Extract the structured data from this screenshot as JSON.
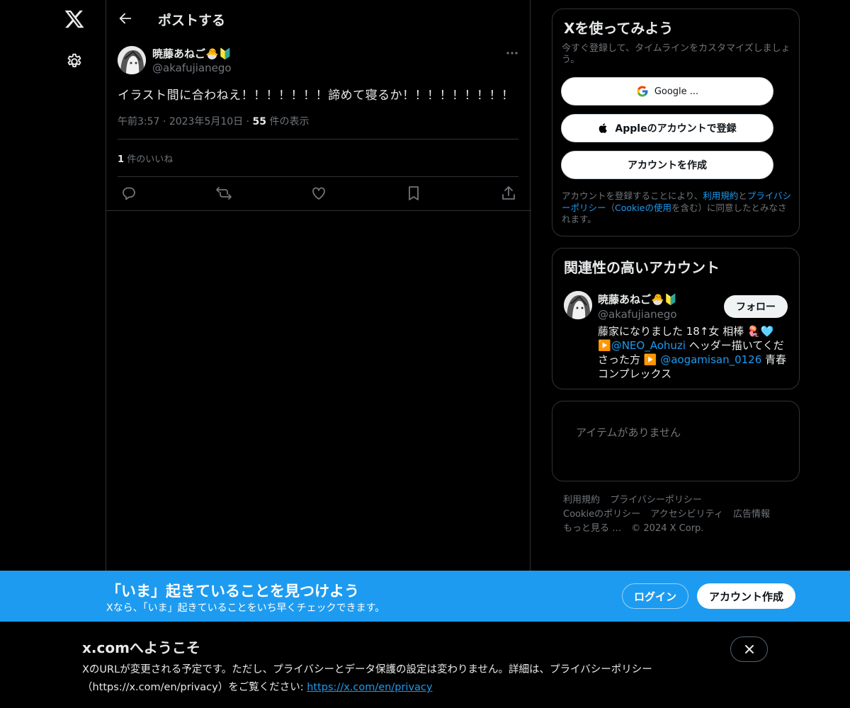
{
  "header": {
    "title": "ポストする"
  },
  "tweet": {
    "author_name": "暁藤あねご🐣🔰",
    "author_handle": "@akafujianego",
    "text": "イラスト間に合わねえ！！！！！！！諦めて寝るか！！！！！！！！！",
    "time": "午前3:57",
    "date": "2023年5月10日",
    "views_count": "55",
    "views_label": "件の表示",
    "likes_count": "1",
    "likes_label": "件のいいね"
  },
  "signup_card": {
    "title": "Xを使ってみよう",
    "subtitle": "今すぐ登録して、タイムラインをカスタマイズしましょう。",
    "google_label": "Google ...",
    "apple_label": "Appleのアカウントで登録",
    "create_label": "アカウントを作成",
    "terms_prefix": "アカウントを登録することにより、",
    "terms_link": "利用規約",
    "terms_and": "と",
    "privacy_link": "プライバシーポリシー",
    "terms_mid": "（",
    "cookie_link": "Cookieの使用",
    "terms_suffix": "を含む）に同意したとみなされます。"
  },
  "related": {
    "title": "関連性の高いアカウント",
    "name": "暁藤あねご🐣🔰",
    "handle": "@akafujianego",
    "follow_label": "フォロー",
    "bio_1": "藤家になりました 18↑女 相棒 🪼🩵▶️",
    "bio_link1": "@NEO_Aohuzi",
    "bio_2": " ヘッダー描いてくださった方 ▶️ ",
    "bio_link2": "@aogamisan_0126",
    "bio_3": " 青春コンプレックス"
  },
  "empty_card": {
    "text": "アイテムがありません"
  },
  "footer": {
    "terms": "利用規約",
    "privacy": "プライバシーポリシー",
    "cookie": "Cookieのポリシー",
    "accessibility": "アクセシビリティ",
    "ads": "広告情報",
    "more": "もっと見る …",
    "copyright": "© 2024 X Corp."
  },
  "banner": {
    "title": "「いま」起きていることを見つけよう",
    "subtitle": "Xなら、「いま」起きていることをいち早くチェックできます。",
    "login_label": "ログイン",
    "signup_label": "アカウント作成"
  },
  "welcome": {
    "title": "x.comへようこそ",
    "body": "XのURLが変更される予定です。ただし、プライバシーとデータ保護の設定は変わりません。詳細は、プライバシーポリシー（https://x.com/en/privacy）をご覧ください: ",
    "link": "https://x.com/en/privacy"
  },
  "colors": {
    "accent": "#1d9bf0",
    "background": "#000000",
    "border": "#2f3336",
    "muted": "#71767b"
  }
}
